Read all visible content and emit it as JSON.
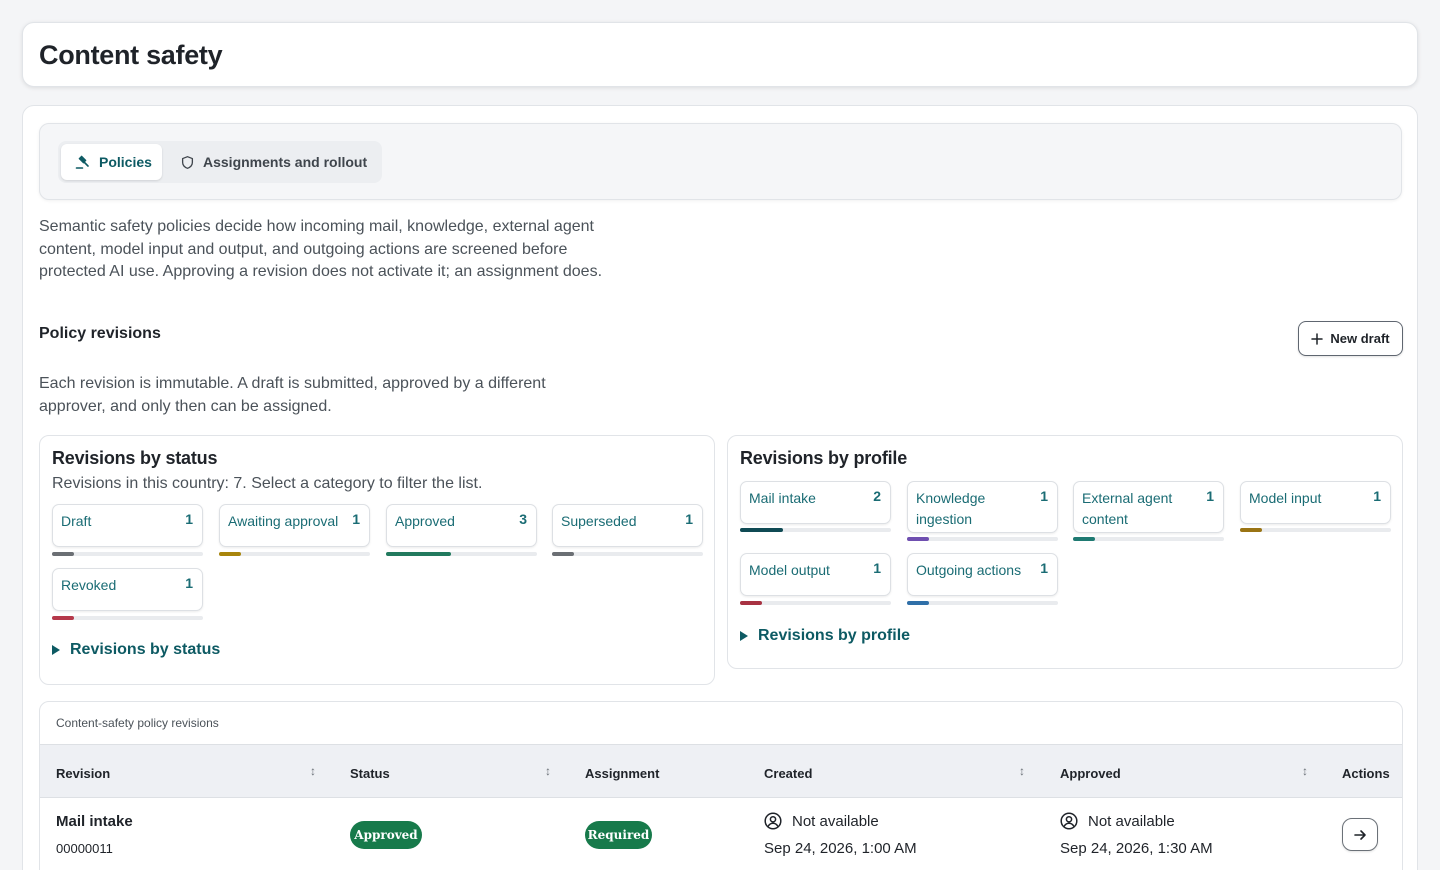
{
  "header": {
    "title": "Content safety"
  },
  "tabs": [
    {
      "label": "Policies",
      "icon": "gavel-icon",
      "active": true
    },
    {
      "label": "Assignments and rollout",
      "icon": "shield-icon",
      "active": false
    }
  ],
  "intro": "Semantic safety policies decide how incoming mail, knowledge, external agent content, model input and output, and outgoing actions are screened before protected AI use. Approving a revision does not activate it; an assignment does.",
  "revisions": {
    "title": "Policy revisions",
    "new_draft_label": "New draft",
    "description": "Each revision is immutable. A draft is submitted, approved by a different approver, and only then can be assigned."
  },
  "by_status": {
    "title": "Revisions by status",
    "subtitle": "Revisions in this country: 7. Select a category to filter the list.",
    "total": 7,
    "items": [
      {
        "label": "Draft",
        "count": "1",
        "color": "#6b6f74"
      },
      {
        "label": "Awaiting approval",
        "count": "1",
        "color": "#a8850c"
      },
      {
        "label": "Approved",
        "count": "3",
        "color": "#227a5e"
      },
      {
        "label": "Superseded",
        "count": "1",
        "color": "#6b6f74"
      },
      {
        "label": "Revoked",
        "count": "1",
        "color": "#b5384a"
      }
    ],
    "toggle_label": "Revisions by status"
  },
  "by_profile": {
    "title": "Revisions by profile",
    "total": 7,
    "items": [
      {
        "label": "Mail intake",
        "count": "2",
        "color": "#0f4a54"
      },
      {
        "label": "Knowledge ingestion",
        "count": "1",
        "color": "#6f4fb0"
      },
      {
        "label": "External agent content",
        "count": "1",
        "color": "#1f7a72"
      },
      {
        "label": "Model input",
        "count": "1",
        "color": "#9a7414"
      },
      {
        "label": "Model output",
        "count": "1",
        "color": "#a83242"
      },
      {
        "label": "Outgoing actions",
        "count": "1",
        "color": "#2f6fa8"
      }
    ],
    "toggle_label": "Revisions by profile"
  },
  "table": {
    "caption": "Content-safety policy revisions",
    "columns": [
      "Revision",
      "Status",
      "Assignment",
      "Created",
      "Approved",
      "Actions"
    ],
    "rows": [
      {
        "revision": "Mail intake",
        "id": "00000011",
        "status": "Approved",
        "assignment": "Required",
        "created_user": "Not available",
        "created_date": "Sep 24, 2026, 1:00 AM",
        "approved_user": "Not available",
        "approved_date": "Sep 24, 2026, 1:30 AM"
      }
    ]
  }
}
